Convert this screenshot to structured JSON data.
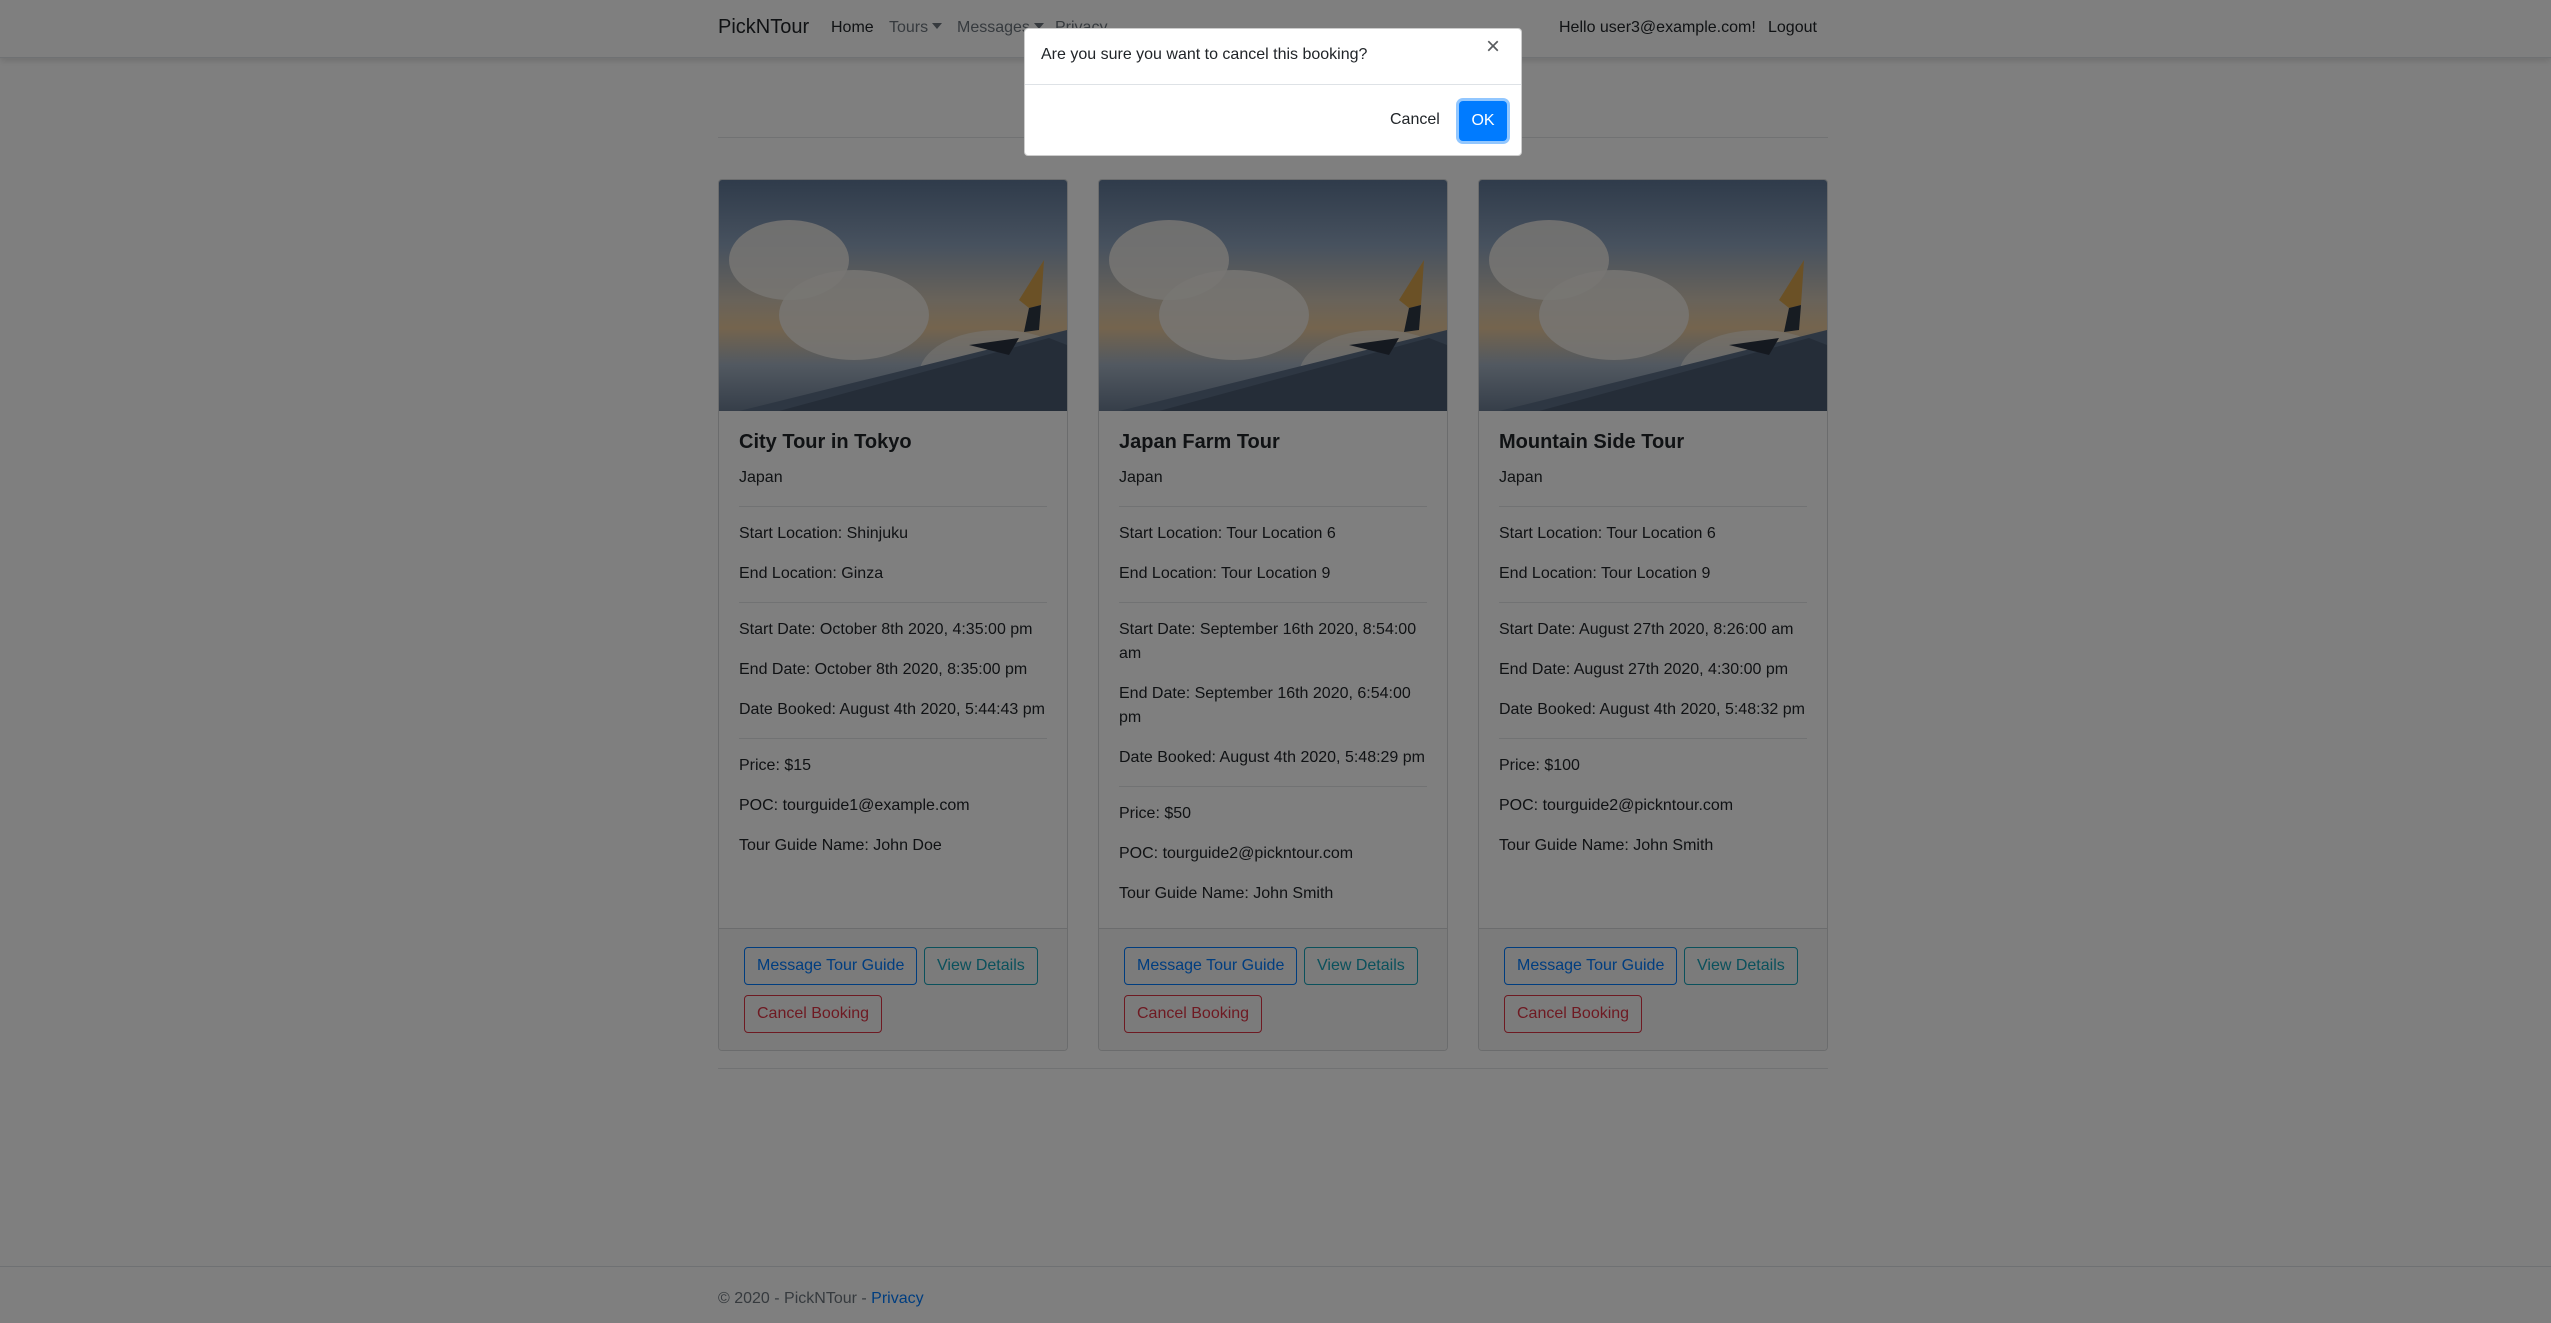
{
  "navbar": {
    "brand": "PickNTour",
    "home": "Home",
    "tours": "Tours",
    "messages": "Messages",
    "privacy": "Privacy",
    "greeting": "Hello user3@example.com!",
    "logout": "Logout"
  },
  "cards": [
    {
      "title": "City Tour in Tokyo",
      "country": "Japan",
      "start_location": "Start Location: Shinjuku",
      "end_location": "End Location: Ginza",
      "start_date": "Start Date: October 8th 2020, 4:35:00 pm",
      "end_date": "End Date: October 8th 2020, 8:35:00 pm",
      "date_booked": "Date Booked: August 4th 2020, 5:44:43 pm",
      "price": "Price: $15",
      "poc": "POC: tourguide1@example.com",
      "guide": "Tour Guide Name: John Doe"
    },
    {
      "title": "Japan Farm Tour",
      "country": "Japan",
      "start_location": "Start Location: Tour Location 6",
      "end_location": "End Location: Tour Location 9",
      "start_date": "Start Date: September 16th 2020, 8:54:00 am",
      "end_date": "End Date: September 16th 2020, 6:54:00 pm",
      "date_booked": "Date Booked: August 4th 2020, 5:48:29 pm",
      "price": "Price: $50",
      "poc": "POC: tourguide2@pickntour.com",
      "guide": "Tour Guide Name: John Smith"
    },
    {
      "title": "Mountain Side Tour",
      "country": "Japan",
      "start_location": "Start Location: Tour Location 6",
      "end_location": "End Location: Tour Location 9",
      "start_date": "Start Date: August 27th 2020, 8:26:00 am",
      "end_date": "End Date: August 27th 2020, 4:30:00 pm",
      "date_booked": "Date Booked: August 4th 2020, 5:48:32 pm",
      "price": "Price: $100",
      "poc": "POC: tourguide2@pickntour.com",
      "guide": "Tour Guide Name: John Smith"
    }
  ],
  "buttons": {
    "message": "Message Tour Guide",
    "details": "View Details",
    "cancel_booking": "Cancel Booking"
  },
  "footer": {
    "text": "© 2020 - PickNTour - ",
    "privacy": "Privacy"
  },
  "modal": {
    "message": "Are you sure you want to cancel this booking?",
    "close": "×",
    "cancel": "Cancel",
    "ok": "OK"
  },
  "colors": {
    "primary": "#007bff",
    "info": "#17a2b8",
    "danger": "#dc3545",
    "backdrop": "rgba(0,0,0,0.5)"
  }
}
